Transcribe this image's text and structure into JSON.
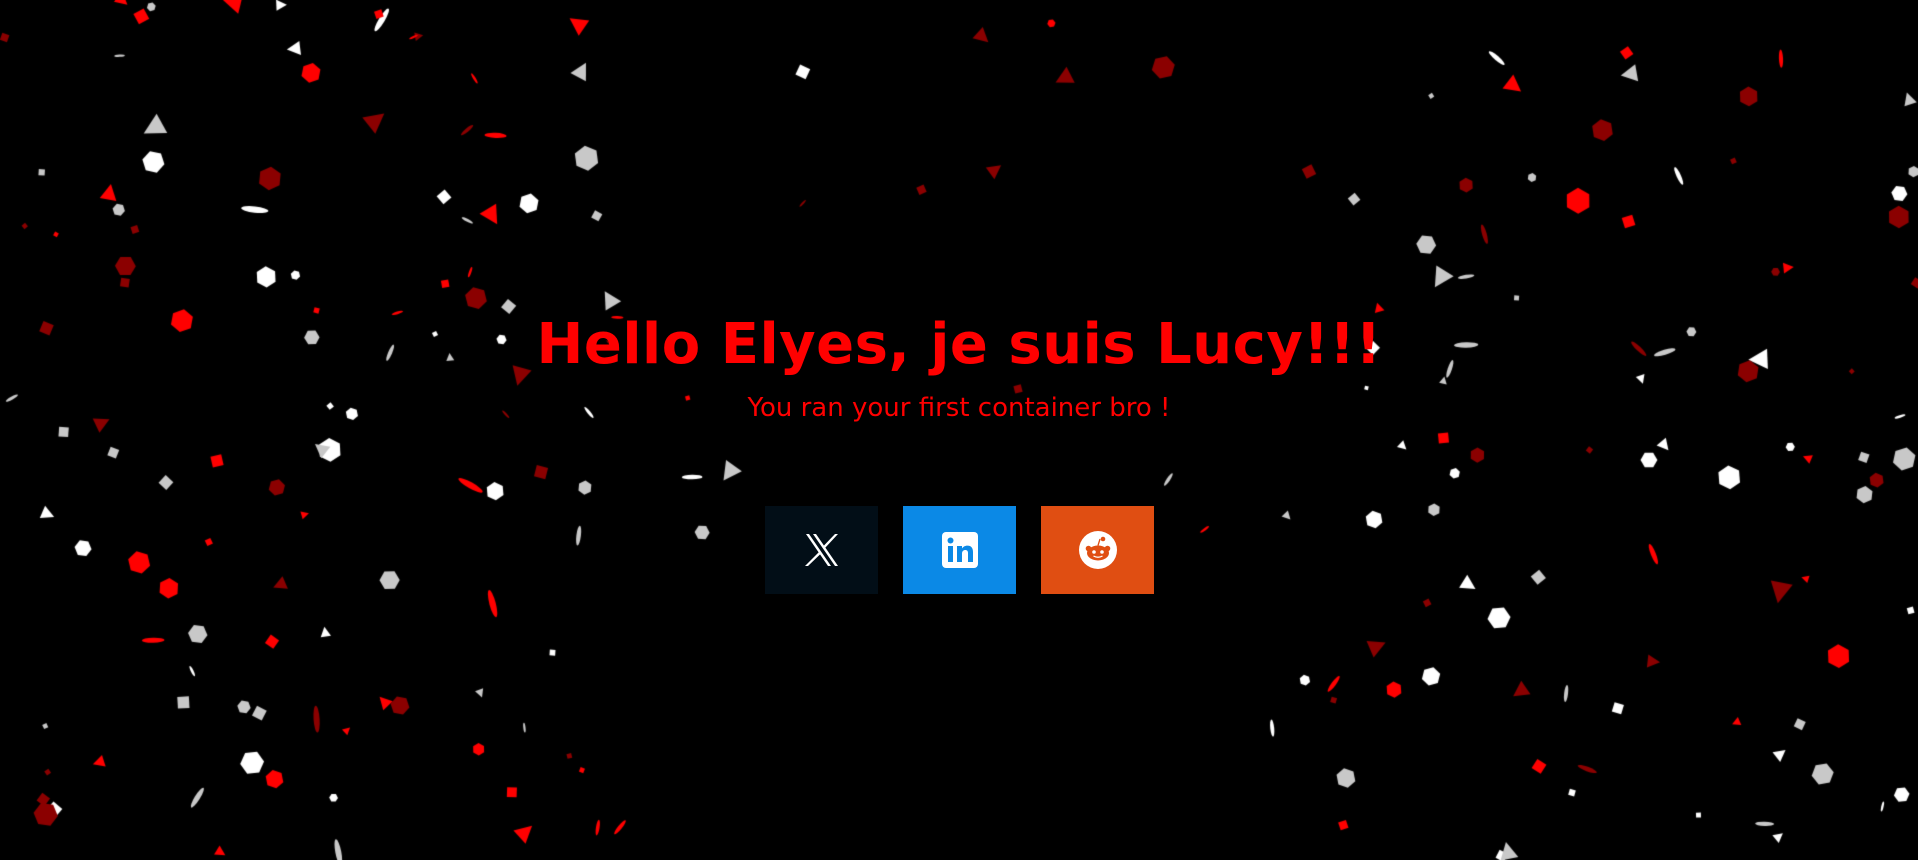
{
  "page": {
    "title": "Hello Elyes, je suis Lucy!!!",
    "subtitle": "You ran your first container bro !"
  },
  "social": [
    {
      "name": "x",
      "icon": "x-logo-icon",
      "color": "#020e17"
    },
    {
      "name": "linkedin",
      "icon": "linkedin-logo-icon",
      "color": "#0b89e6"
    },
    {
      "name": "reddit",
      "icon": "reddit-logo-icon",
      "color": "#e04e12"
    }
  ],
  "colors": {
    "background": "#000000",
    "accent": "#ff0000",
    "confetti_colors": [
      "#ff0000",
      "#ffffff",
      "#8b0000",
      "#c8c8c8"
    ]
  }
}
